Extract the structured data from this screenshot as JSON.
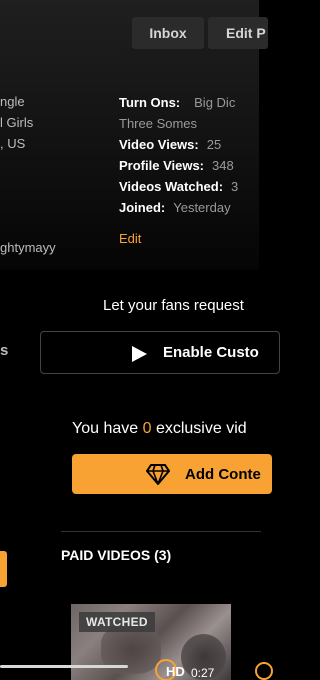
{
  "header": {
    "inbox_label": "Inbox",
    "edit_label": "Edit P"
  },
  "profile": {
    "left_lines": [
      "ngle",
      "l Girls",
      ", US"
    ],
    "username_fragment": "ghtymayy",
    "turn_ons_label": "Turn Ons:",
    "turn_ons_value": "Big   Dic",
    "turn_ons_value_line2": "Three Somes",
    "video_views_label": "Video Views:",
    "video_views_value": "25",
    "profile_views_label": "Profile Views:",
    "profile_views_value": "348",
    "videos_watched_label": "Videos Watched:",
    "videos_watched_value": "3",
    "joined_label": "Joined:",
    "joined_value": "Yesterday",
    "edit_link": "Edit"
  },
  "requests": {
    "fans_text": "Let your fans request",
    "left_fragment": "s",
    "enable_label": "Enable Custo"
  },
  "exclusive": {
    "prefix": "You have",
    "count": "0",
    "suffix": "exclusive vid",
    "add_label": "Add Conte"
  },
  "paid_videos": {
    "heading": "PAID VIDEOS (3)",
    "items": [
      {
        "badge": "WATCHED",
        "quality": "HD",
        "duration": "0:27"
      }
    ]
  },
  "colors": {
    "accent": "#f7a233",
    "background": "#000000"
  },
  "icons": [
    "play-icon",
    "diamond-icon"
  ]
}
